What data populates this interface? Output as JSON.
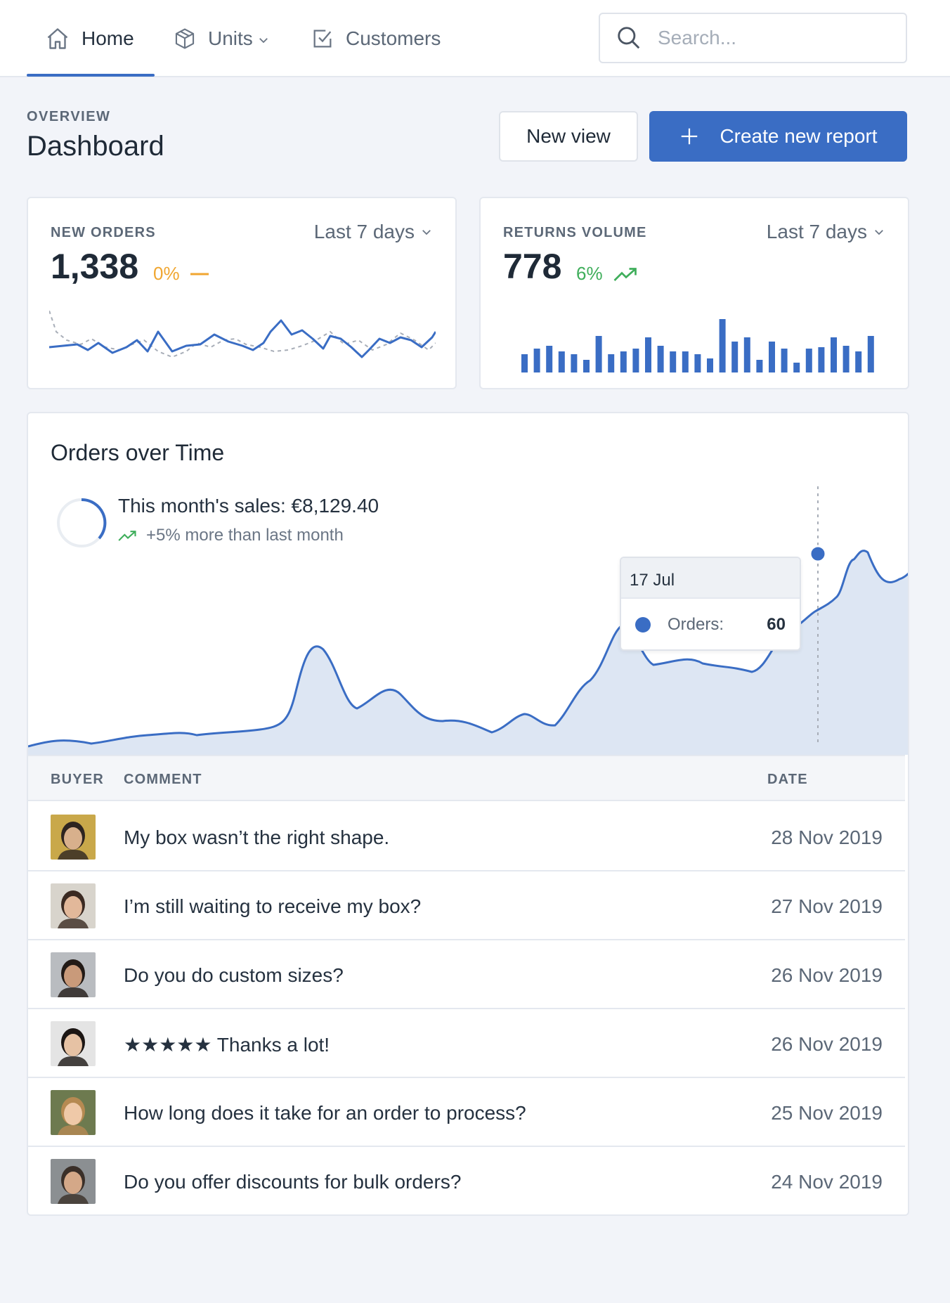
{
  "nav": {
    "items": [
      {
        "label": "Home",
        "icon": "home-icon",
        "active": true
      },
      {
        "label": "Units",
        "icon": "cube-icon",
        "dropdown": true
      },
      {
        "label": "Customers",
        "icon": "checkbox-icon"
      }
    ],
    "search_placeholder": "Search..."
  },
  "header": {
    "eyebrow": "OVERVIEW",
    "title": "Dashboard",
    "new_view_label": "New view",
    "create_label": "Create new report"
  },
  "cards": {
    "orders": {
      "label": "NEW ORDERS",
      "period": "Last 7 days",
      "value": "1,338",
      "delta": "0%",
      "delta_color": "#f0a630",
      "trend": "flat"
    },
    "returns": {
      "label": "RETURNS VOLUME",
      "period": "Last 7 days",
      "value": "778",
      "delta": "6%",
      "delta_color": "#3fae5b",
      "trend": "up"
    }
  },
  "orders_over_time": {
    "title": "Orders over Time",
    "sales_text": "This month's sales: €8,129.40",
    "sales_sub": "+5% more than last month",
    "tooltip": {
      "date": "17 Jul",
      "label": "Orders:",
      "value": "60"
    }
  },
  "table": {
    "headers": {
      "buyer": "BUYER",
      "comment": "COMMENT",
      "date": "DATE"
    },
    "rows": [
      {
        "comment": "My box wasn’t the right shape.",
        "date": "28 Nov 2019"
      },
      {
        "comment": "I’m still waiting to receive my box?",
        "date": "27 Nov 2019"
      },
      {
        "comment": "Do you do custom sizes?",
        "date": "26 Nov 2019"
      },
      {
        "comment": "★★★★★ Thanks a lot!",
        "date": "26 Nov 2019"
      },
      {
        "comment": "How long does it take for an order to process?",
        "date": "25 Nov 2019"
      },
      {
        "comment": "Do you offer discounts for bulk orders?",
        "date": "24 Nov 2019"
      }
    ]
  },
  "colors": {
    "accent": "#3a6dc4",
    "area_fill": "#dde6f3"
  }
}
